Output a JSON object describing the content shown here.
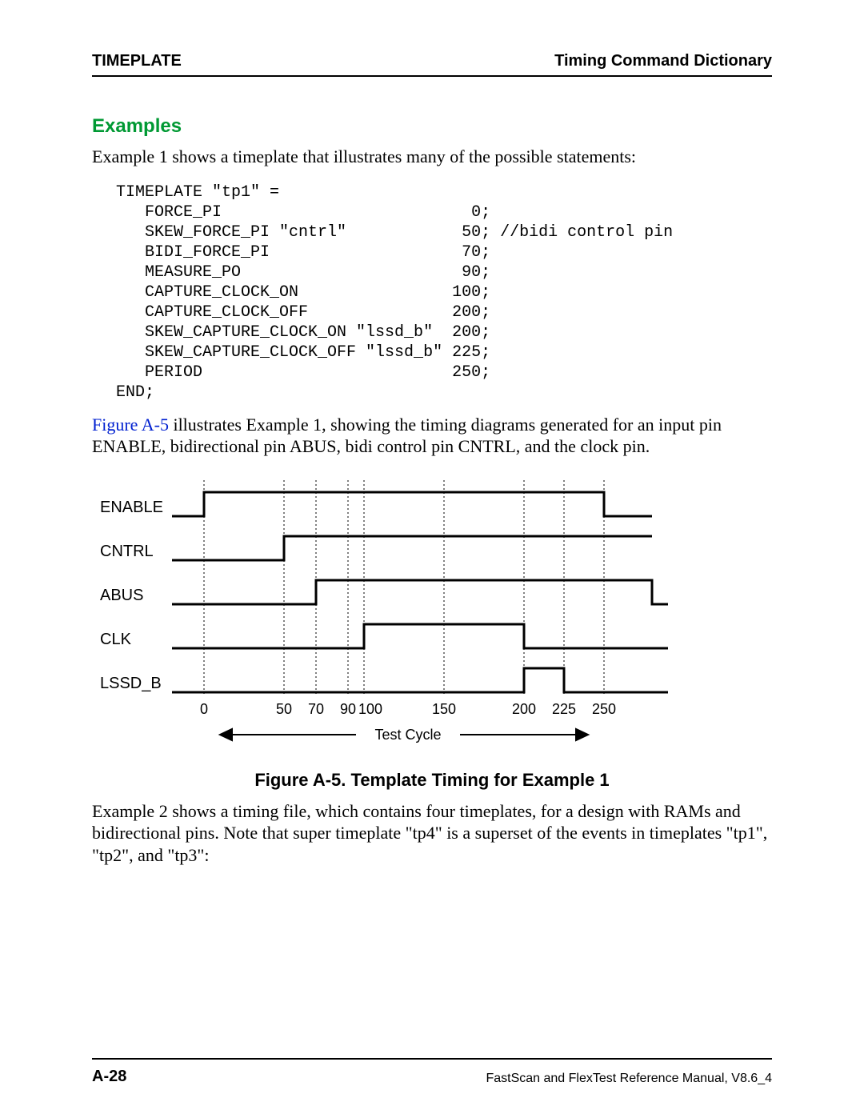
{
  "header": {
    "left": "TIMEPLATE",
    "right": "Timing Command Dictionary"
  },
  "section_title": "Examples",
  "intro_text": "Example 1 shows a timeplate that illustrates many of the possible statements:",
  "code": "TIMEPLATE \"tp1\" =\n   FORCE_PI                          0;\n   SKEW_FORCE_PI \"cntrl\"            50; //bidi control pin\n   BIDI_FORCE_PI                    70;\n   MEASURE_PO                       90;\n   CAPTURE_CLOCK_ON                100;\n   CAPTURE_CLOCK_OFF               200;\n   SKEW_CAPTURE_CLOCK_ON \"lssd_b\"  200;\n   SKEW_CAPTURE_CLOCK_OFF \"lssd_b\" 225;\n   PERIOD                          250;\nEND;",
  "after_code_link": "Figure A-5",
  "after_code_rest": " illustrates Example 1, showing the timing diagrams generated for an input pin ENABLE, bidirectional pin ABUS, bidi control pin CNTRL, and the clock pin.",
  "figure": {
    "signals": [
      "ENABLE",
      "CNTRL",
      "ABUS",
      "CLK",
      "LSSD_B"
    ],
    "ticks": [
      "0",
      "50",
      "70",
      "90",
      "100",
      "150",
      "200",
      "225",
      "250"
    ],
    "axis_label": "Test Cycle"
  },
  "figure_caption": "Figure A-5. Template Timing for Example 1",
  "example2_text": "Example 2 shows a timing file, which contains four timeplates, for a design with RAMs and bidirectional pins. Note that super timeplate \"tp4\" is a superset of the events in timeplates \"tp1\", \"tp2\", and \"tp3\":",
  "footer": {
    "page": "A-28",
    "manual": "FastScan and FlexTest Reference Manual, V8.6_4"
  },
  "chart_data": {
    "type": "timing-diagram",
    "period": 250,
    "tick_values": [
      0,
      50,
      70,
      90,
      100,
      150,
      200,
      225,
      250
    ],
    "signals": [
      {
        "name": "ENABLE",
        "edges": [
          {
            "t": 0,
            "level": 0
          },
          {
            "t": 0,
            "rise_to": 1
          },
          {
            "t": 250,
            "fall_to": 0
          }
        ]
      },
      {
        "name": "CNTRL",
        "edges": [
          {
            "t": 0,
            "level": 0
          },
          {
            "t": 50,
            "rise_to": 1
          },
          {
            "t": 250,
            "hold": 1
          }
        ]
      },
      {
        "name": "ABUS",
        "edges": [
          {
            "t": 0,
            "level": 0
          },
          {
            "t": 70,
            "rise_to": 1
          },
          {
            "t": 250,
            "hold": 1
          }
        ]
      },
      {
        "name": "CLK",
        "edges": [
          {
            "t": 0,
            "level": 0
          },
          {
            "t": 100,
            "rise_to": 1
          },
          {
            "t": 200,
            "fall_to": 0
          }
        ]
      },
      {
        "name": "LSSD_B",
        "edges": [
          {
            "t": 0,
            "level": 0
          },
          {
            "t": 200,
            "rise_to": 1
          },
          {
            "t": 225,
            "fall_to": 0
          }
        ]
      }
    ],
    "axis_label": "Test Cycle"
  }
}
